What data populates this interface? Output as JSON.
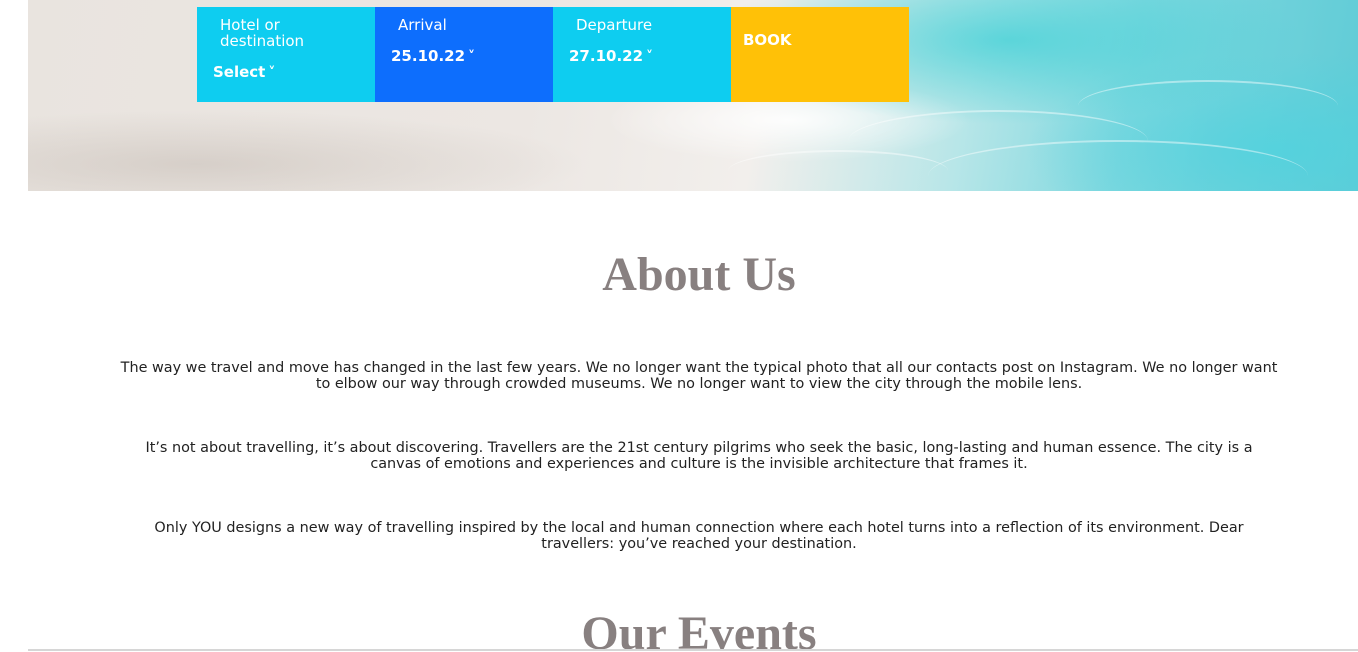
{
  "booking": {
    "hotel_label": "Hotel or destination",
    "hotel_value": "Select",
    "arrival_label": "Arrival",
    "arrival_value": "25.10.22",
    "departure_label": "Departure",
    "departure_value": "27.10.22",
    "book_label": "BOOK",
    "colors": {
      "cyan": "#0ecdf0",
      "blue": "#0d6efd",
      "yellow": "#ffc107"
    }
  },
  "about": {
    "title": "About Us",
    "paragraphs": [
      "The way we travel and move has changed in the last few years. We no longer want the typical photo that all our contacts post on Instagram. We no longer want to elbow our way through crowded museums. We no longer want to view the city through the mobile lens.",
      "It’s not about travelling, it’s about discovering. Travellers are the 21st century pilgrims who seek the basic, long-lasting and human essence. The city is a canvas of emotions and experiences and culture is the invisible architecture that frames it.",
      "Only YOU designs a new way of travelling inspired by the local and human connection where each hotel turns into a reflection of its environment. Dear travellers: you’ve reached your destination."
    ]
  },
  "events": {
    "title": "Our Events"
  },
  "icons": {
    "dropdown": "chevron-down-icon"
  }
}
